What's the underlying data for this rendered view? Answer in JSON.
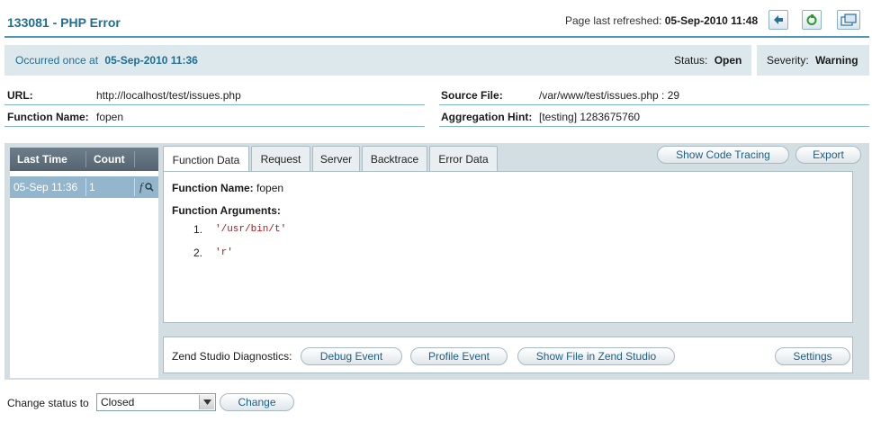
{
  "header": {
    "title": "133081 - PHP Error",
    "refresh_label": "Page last refreshed:",
    "refresh_value": "05-Sep-2010 11:48"
  },
  "summary": {
    "occurred_label": "Occurred once at",
    "occurred_value": "05-Sep-2010 11:36",
    "status_label": "Status:",
    "status_value": "Open",
    "severity_label": "Severity:",
    "severity_value": "Warning"
  },
  "details": {
    "url_label": "URL:",
    "url_value": "http://localhost/test/issues.php",
    "function_label": "Function Name:",
    "function_value": "fopen",
    "source_label": "Source File:",
    "source_value": "/var/www/test/issues.php : 29",
    "hint_label": "Aggregation Hint:",
    "hint_value": "[testing] 1283675760"
  },
  "events_grid": {
    "columns": [
      "Last Time",
      "Count"
    ],
    "rows": [
      {
        "time": "05-Sep 11:36",
        "count": "1"
      }
    ]
  },
  "tabs": [
    "Function Data",
    "Request",
    "Server",
    "Backtrace",
    "Error Data"
  ],
  "active_tab": "Function Data",
  "actions": {
    "show_code_tracing": "Show Code Tracing",
    "export": "Export"
  },
  "function_data": {
    "name_label": "Function Name:",
    "name_value": "fopen",
    "args_label": "Function Arguments:",
    "args": [
      {
        "index": "1.",
        "value": "'/usr/bin/t'"
      },
      {
        "index": "2.",
        "value": "'r'"
      }
    ]
  },
  "diagnostics": {
    "label": "Zend Studio Diagnostics:",
    "debug_event": "Debug Event",
    "profile_event": "Profile Event",
    "show_file": "Show File in Zend Studio",
    "settings": "Settings"
  },
  "change_status": {
    "label": "Change status to",
    "selected": "Closed",
    "button": "Change"
  },
  "colors": {
    "accent": "#1d6f96",
    "panel_bg": "#d2dee2",
    "summary_bg": "#dce8ec",
    "selected_row": "#93b6cc",
    "grid_header": "#5d6d79",
    "code_red": "#b0141a"
  },
  "icons": {
    "back": "back-arrow-icon",
    "refresh": "refresh-icon",
    "popout": "popout-window-icon",
    "row_action": "function-search-icon"
  }
}
